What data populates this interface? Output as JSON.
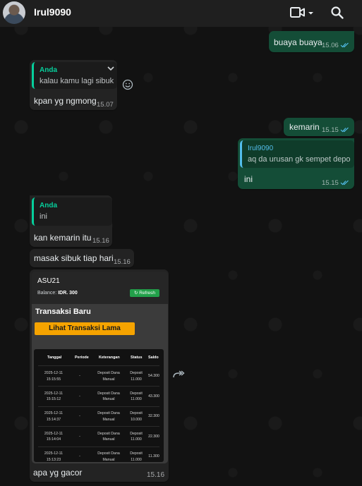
{
  "header": {
    "contact_name": "Irul9090",
    "icons": [
      "video-call-icon",
      "caret-down-icon",
      "search-icon"
    ]
  },
  "messages": [
    {
      "side": "out",
      "text": "buaya buaya",
      "time": "15.06",
      "status": "read"
    },
    {
      "side": "in",
      "quote_author": "Anda",
      "quote_text": "kalau kamu lagi sibuk",
      "text": "kpan yg ngmong",
      "time": "15.07"
    },
    {
      "side": "out",
      "text": "kemarin",
      "time": "15.15",
      "status": "read"
    },
    {
      "side": "out",
      "quote_author": "Irul9090",
      "quote_text": "aq da urusan gk sempet depo",
      "text": "ini",
      "time": "15.15",
      "status": "read"
    },
    {
      "side": "in",
      "quote_author": "Anda",
      "quote_text": "ini",
      "text": "kan kemarin itu",
      "time": "15.16"
    },
    {
      "side": "in",
      "text": "masak sibuk tiap hari",
      "time": "15.16"
    },
    {
      "side": "in",
      "type": "image",
      "caption": "apa yg gacor",
      "time": "15.16"
    }
  ],
  "image_content": {
    "title": "ASU21",
    "balance_label": "Balance:",
    "balance_value": "IDR. 300",
    "refresh_label": "Refresh",
    "section_title": "Transaksi Baru",
    "old_tx_button": "Lihat Transaksi Lama",
    "columns": [
      "Tanggal",
      "Periode",
      "Keterangan",
      "Status",
      "Saldo"
    ],
    "rows": [
      {
        "date": "2025-12-11",
        "time": "15:15:55",
        "periode": "-",
        "ket1": "Deposit Dana",
        "ket2": "Manual",
        "status1": "Deposit",
        "status2": "11.000",
        "saldo": "54.300"
      },
      {
        "date": "2025-12-11",
        "time": "15:15:12",
        "periode": "-",
        "ket1": "Deposit Dana",
        "ket2": "Manual",
        "status1": "Deposit",
        "status2": "11.000",
        "saldo": "43.300"
      },
      {
        "date": "2025-12-11",
        "time": "15:14:37",
        "periode": "-",
        "ket1": "Deposit Dana",
        "ket2": "Manual",
        "status1": "Deposit",
        "status2": "10.000",
        "saldo": "32.300"
      },
      {
        "date": "2025-12-11",
        "time": "15:14:04",
        "periode": "-",
        "ket1": "Deposit Dana",
        "ket2": "Manual",
        "status1": "Deposit",
        "status2": "11.000",
        "saldo": "22.300"
      },
      {
        "date": "2025-12-11",
        "time": "15:13:23",
        "periode": "-",
        "ket1": "Deposit Dana",
        "ket2": "Manual",
        "status1": "Deposit",
        "status2": "11.000",
        "saldo": "11.300"
      }
    ]
  },
  "colors": {
    "outgoing_bubble": "#144d37",
    "incoming_bubble": "#232323",
    "quote_bar_green": "#06cf9c",
    "quote_bar_blue": "#53bdeb",
    "read_ticks": "#53bdeb"
  }
}
